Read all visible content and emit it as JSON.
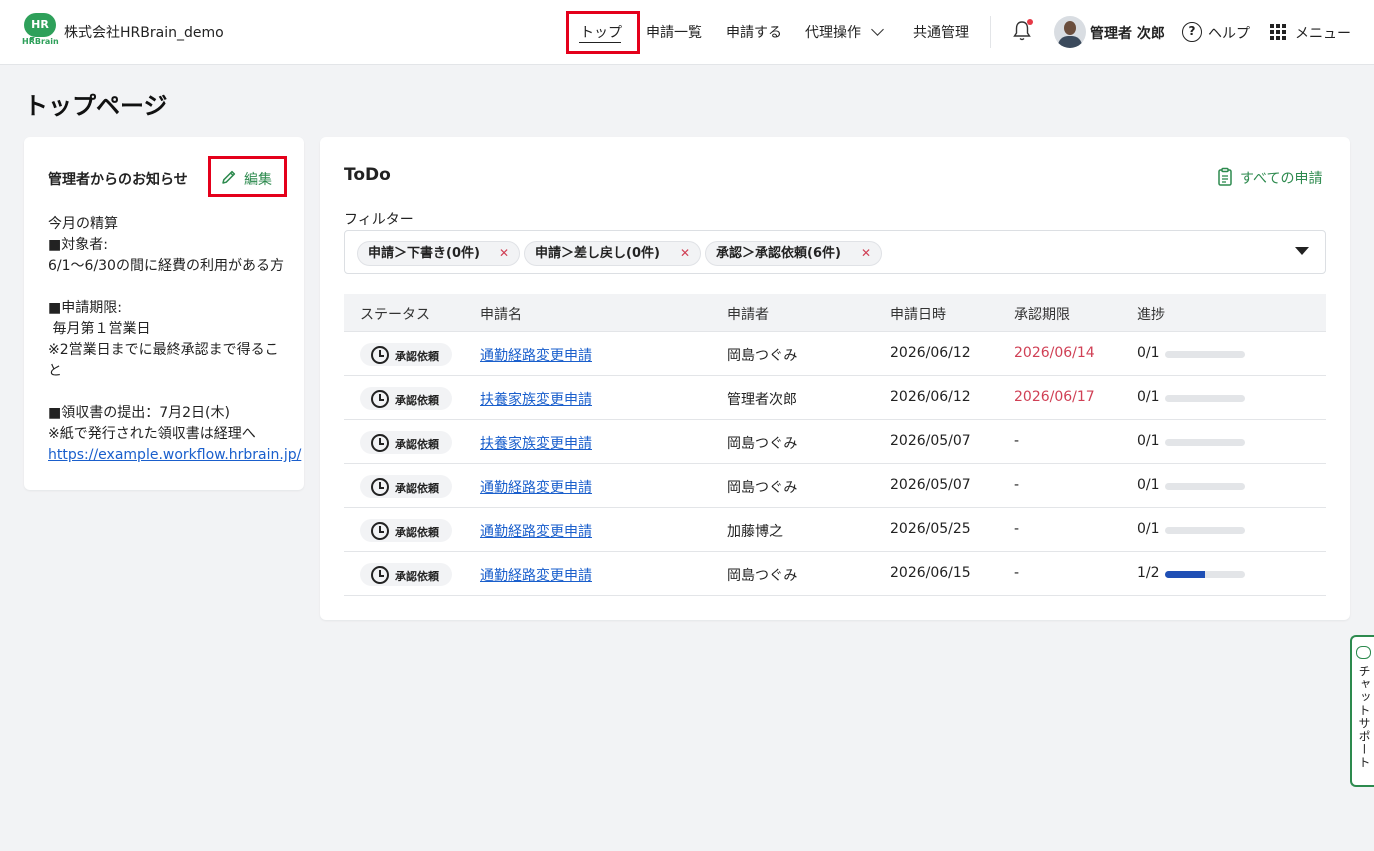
{
  "header": {
    "company": "株式会社HRBrain_demo",
    "logo_text": "HR",
    "logo_word": "HRBrain",
    "nav": [
      {
        "label": "トップ",
        "active": true
      },
      {
        "label": "申請一覧"
      },
      {
        "label": "申請する"
      },
      {
        "label": "代理操作"
      },
      {
        "label": "共通管理"
      }
    ],
    "user_name": "管理者 次郎",
    "help_label": "ヘルプ",
    "help_icon_glyph": "?",
    "menu_label": "メニュー"
  },
  "page": {
    "title": "トップページ"
  },
  "notice": {
    "title": "管理者からのお知らせ",
    "edit_label": "編集",
    "lines": [
      "今月の精算",
      "■対象者:",
      "6/1〜6/30の間に経費の利用がある方",
      "",
      "■申請期限:",
      " 毎月第１営業日",
      "※2営業日までに最終承認まで得ること",
      "",
      "■領収書の提出：7月2日(木)",
      "※紙で発行された領収書は経理へ"
    ],
    "link": "https://example.workflow.hrbrain.jp/"
  },
  "todo": {
    "title": "ToDo",
    "all_apps_label": "すべての申請",
    "filter_label": "フィルター",
    "filters": [
      "申請＞下書き(0件)",
      "申請＞差し戻し(0件)",
      "承認＞承認依頼(6件)"
    ],
    "filter_remove_glyph": "✕",
    "columns": [
      "ステータス",
      "申請名",
      "申請者",
      "申請日時",
      "承認期限",
      "進捗"
    ],
    "rows": [
      {
        "status": "承認依頼",
        "name": "通勤経路変更申請",
        "applicant": "岡島つぐみ",
        "date": "2026/06/12",
        "deadline": "2026/06/14",
        "deadline_overdue": true,
        "progress": "0/1",
        "progress_fraction": 0
      },
      {
        "status": "承認依頼",
        "name": "扶養家族変更申請",
        "applicant": "管理者次郎",
        "date": "2026/06/12",
        "deadline": "2026/06/17",
        "deadline_overdue": true,
        "progress": "0/1",
        "progress_fraction": 0
      },
      {
        "status": "承認依頼",
        "name": "扶養家族変更申請",
        "applicant": "岡島つぐみ",
        "date": "2026/05/07",
        "deadline": "-",
        "deadline_overdue": false,
        "progress": "0/1",
        "progress_fraction": 0
      },
      {
        "status": "承認依頼",
        "name": "通勤経路変更申請",
        "applicant": "岡島つぐみ",
        "date": "2026/05/07",
        "deadline": "-",
        "deadline_overdue": false,
        "progress": "0/1",
        "progress_fraction": 0
      },
      {
        "status": "承認依頼",
        "name": "通勤経路変更申請",
        "applicant": "加藤博之",
        "date": "2026/05/25",
        "deadline": "-",
        "deadline_overdue": false,
        "progress": "0/1",
        "progress_fraction": 0
      },
      {
        "status": "承認依頼",
        "name": "通勤経路変更申請",
        "applicant": "岡島つぐみ",
        "date": "2026/06/15",
        "deadline": "-",
        "deadline_overdue": false,
        "progress": "1/2",
        "progress_fraction": 0.5
      }
    ]
  },
  "chat_support": {
    "label": "チャットサポート"
  },
  "colors": {
    "brand_green": "#2ea05a",
    "link_blue": "#1a5fcc",
    "overdue_red": "#d04055",
    "progress_blue": "#1f4fb5",
    "highlight_red": "#e4001b"
  }
}
